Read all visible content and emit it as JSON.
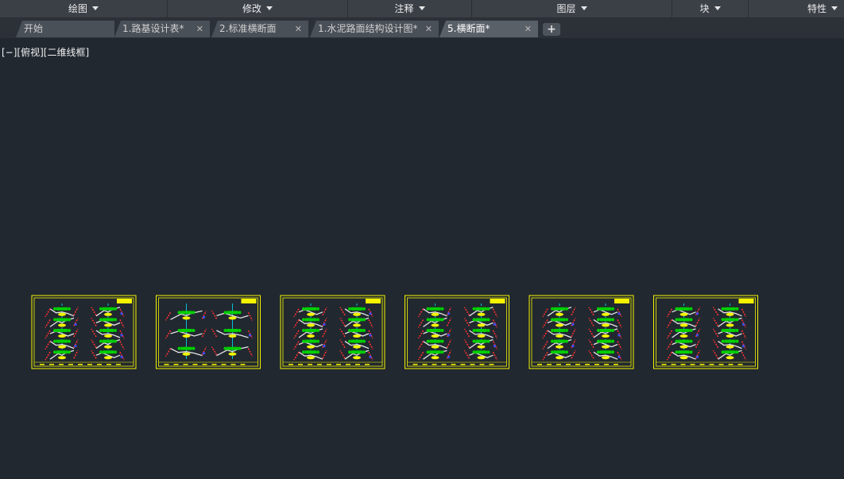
{
  "ribbon": {
    "panels": [
      {
        "label": "绘图"
      },
      {
        "label": "修改"
      },
      {
        "label": "注释"
      },
      {
        "label": "图层"
      },
      {
        "label": "块"
      },
      {
        "label": "特性"
      }
    ]
  },
  "tabs": [
    {
      "label": "开始",
      "closable": false,
      "active": false
    },
    {
      "label": "1.路基设计表*",
      "closable": true,
      "active": false
    },
    {
      "label": "2.标准横断面",
      "closable": true,
      "active": false
    },
    {
      "label": "1.水泥路面结构设计图*",
      "closable": true,
      "active": false
    },
    {
      "label": "5.横断面*",
      "closable": true,
      "active": true
    }
  ],
  "tab_close_glyph": "✕",
  "new_tab_glyph": "+",
  "viewport": {
    "controls_label": "[−][俯视][二维线框]"
  },
  "drawing": {
    "sheet_count": 6,
    "colors": {
      "background": "#212830",
      "frame": "#f5f500",
      "centerline": "#00e5ff",
      "fill": "#00d000",
      "ground": "#e6e6e6",
      "slope": "#ff3030",
      "marker": "#3a4cff"
    }
  }
}
